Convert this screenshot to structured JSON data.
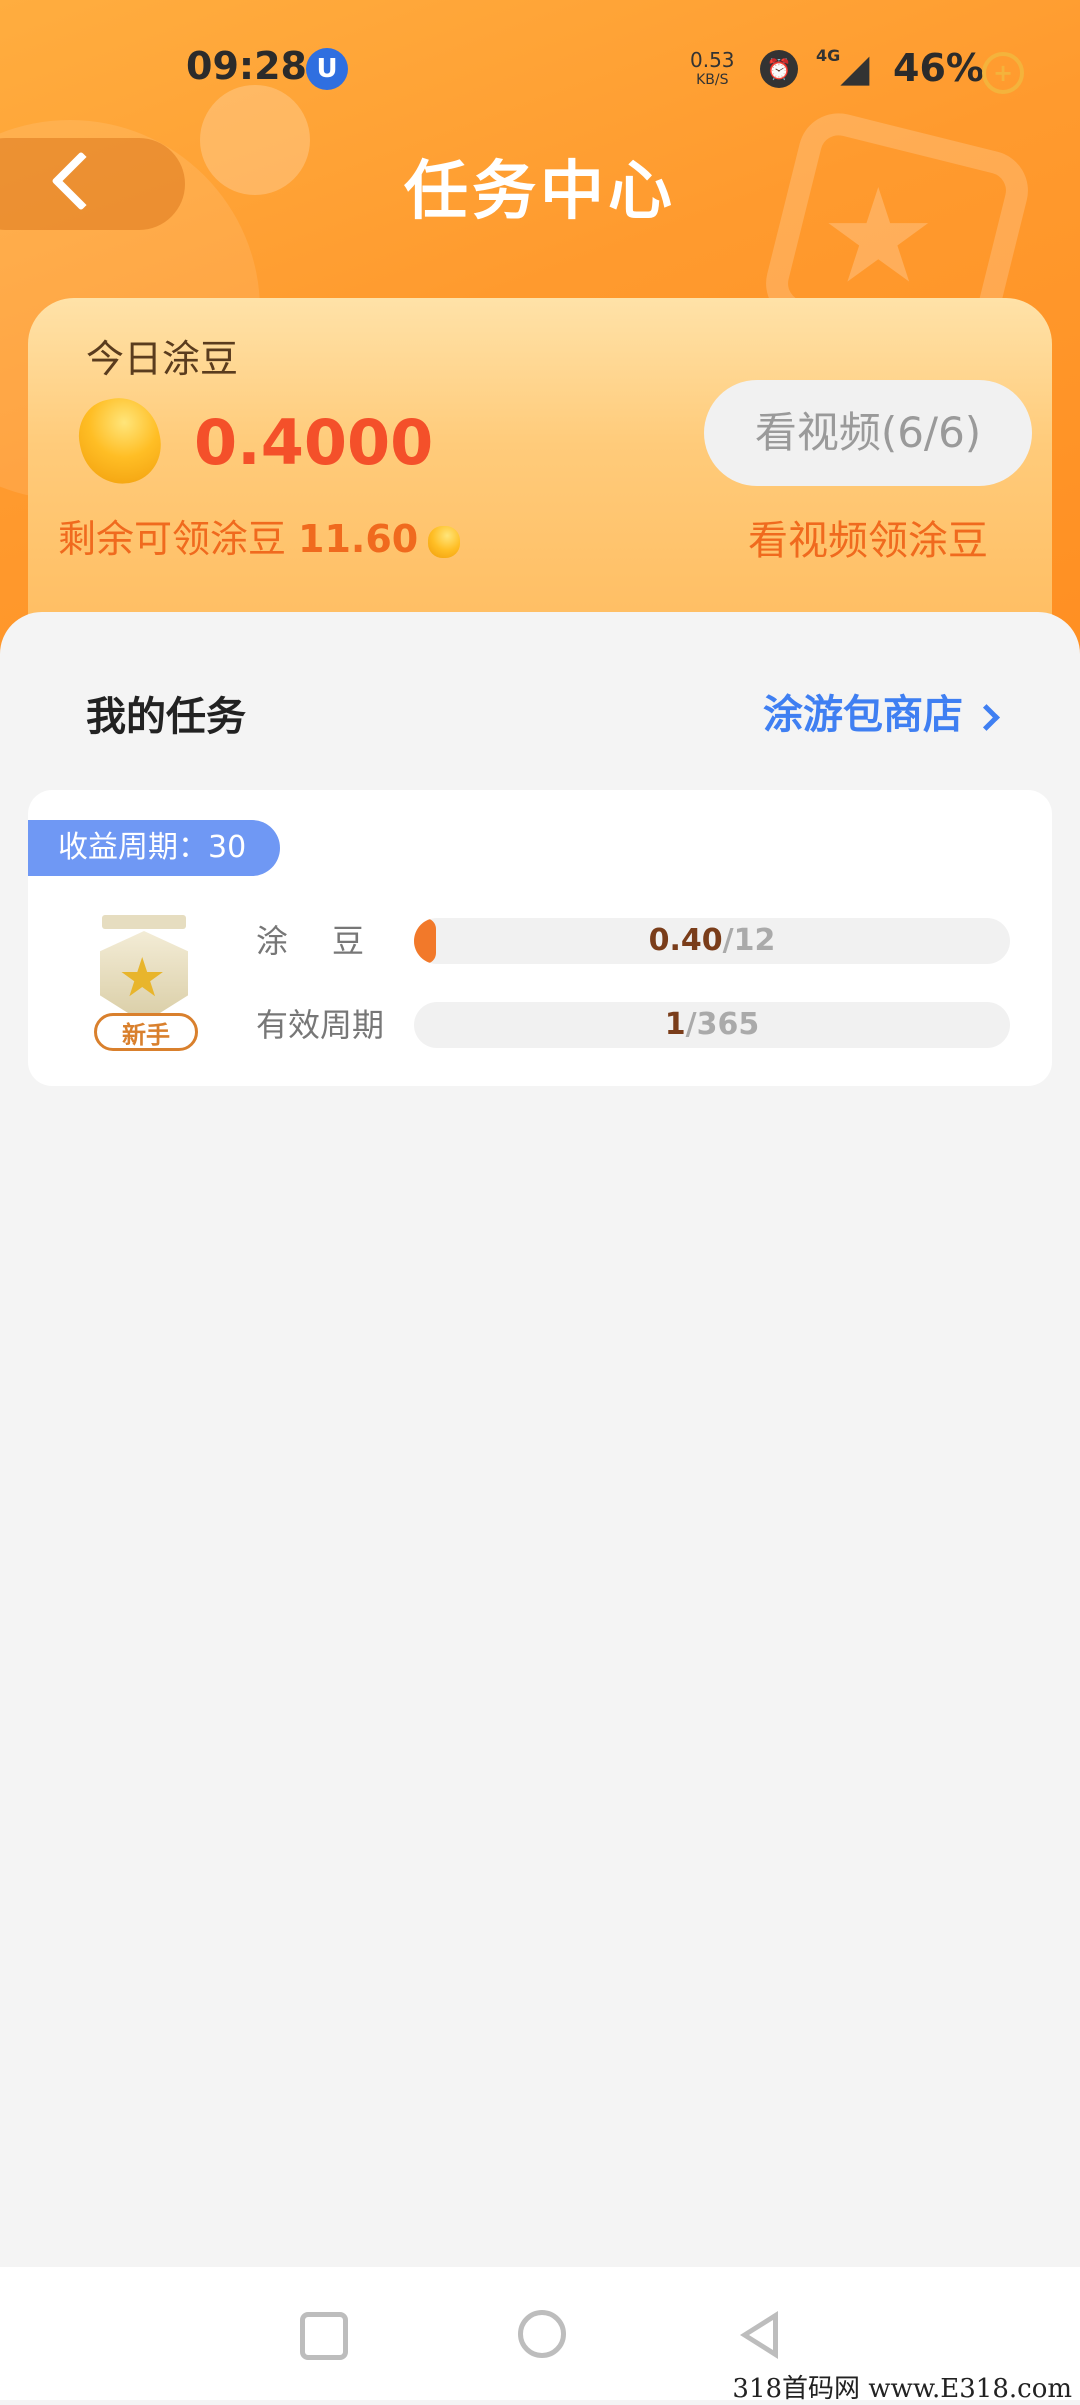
{
  "status_bar": {
    "time": "09:28",
    "app_icon": "U",
    "net_speed": "0.53",
    "net_unit": "KB/S",
    "signal_type": "4G",
    "battery": "46%",
    "icons": [
      "alarm-icon",
      "signal-icon",
      "battery-saver-icon"
    ]
  },
  "header": {
    "title": "任务中心"
  },
  "summary": {
    "label": "今日涂豆",
    "amount": "0.4000",
    "watch_button": "看视频(6/6)",
    "remaining_label": "剩余可领涂豆",
    "remaining_value": "11.60",
    "watch_link": "看视频领涂豆"
  },
  "tasks_section": {
    "title": "我的任务",
    "shop_link": "涂游包商店",
    "tasks": [
      {
        "period_tag": "收益周期：30",
        "badge_label": "新手",
        "bean_label": "涂豆",
        "bean_current": "0.40",
        "bean_total": "/12",
        "bean_progress": 0.033,
        "cycle_label": "有效周期",
        "cycle_current": "1",
        "cycle_total": "/365",
        "cycle_progress": 0.003
      }
    ]
  },
  "nav_bar": {
    "icons": [
      "recent-apps-icon",
      "home-icon",
      "back-icon"
    ]
  },
  "watermark": "318首码网 www.E318.com",
  "colors": {
    "header_orange": "#ff9a2e",
    "amount_red": "#f4502a",
    "link_blue": "#3f7ff2",
    "tag_blue": "#6f98f4",
    "progress_orange": "#f2792a"
  }
}
